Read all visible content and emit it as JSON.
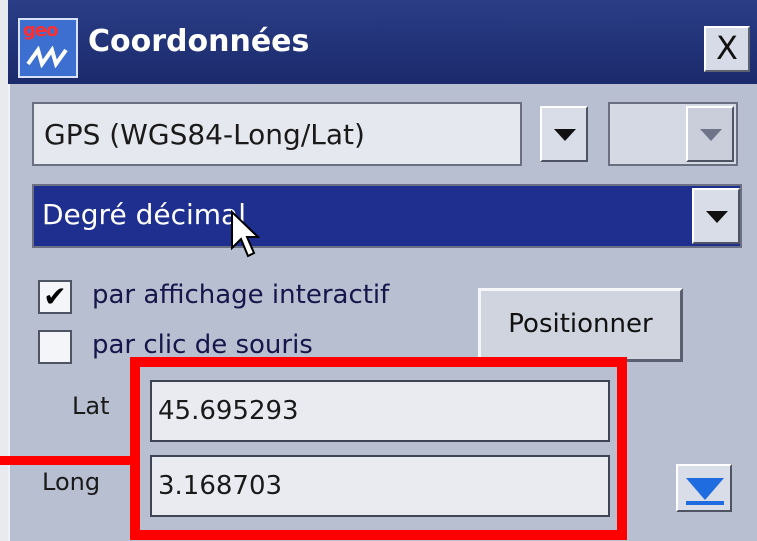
{
  "window": {
    "title": "Coordonnées",
    "logo_text": "geo",
    "close_label": "X"
  },
  "coordinate_system": {
    "selected": "GPS (WGS84-Long/Lat)"
  },
  "format": {
    "selected": "Degré décimal"
  },
  "options": [
    {
      "label": "par affichage interactif",
      "checked": true
    },
    {
      "label": "par clic de souris",
      "checked": false
    }
  ],
  "position_button": "Positionner",
  "fields": {
    "lat_label": "Lat",
    "lat_value": "45.695293",
    "long_label": "Long",
    "long_value": "3.168703"
  },
  "colors": {
    "titlebar": "#1b2a6b",
    "selection": "#1e2f90",
    "highlight": "#ff0000",
    "arrow": "#1f6be0"
  }
}
